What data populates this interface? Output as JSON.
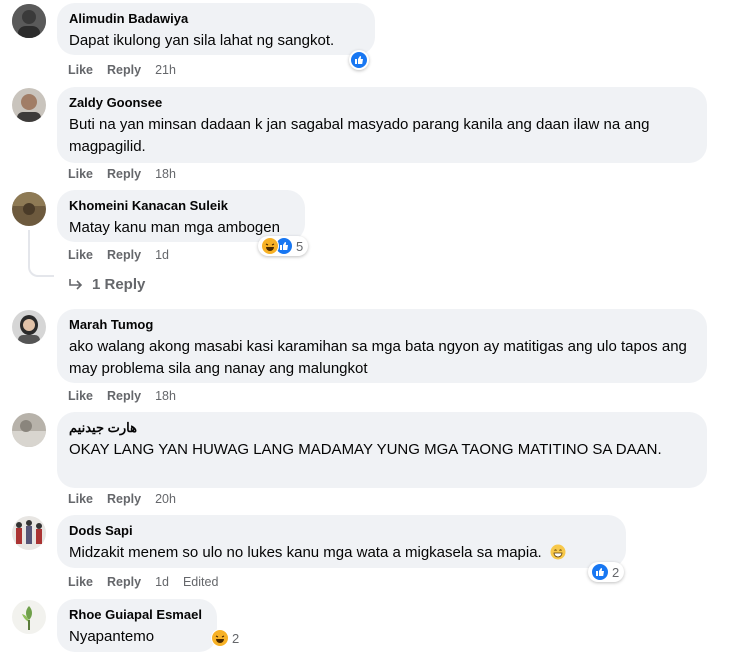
{
  "comments": [
    {
      "author": "Alimudin Badawiya",
      "text": "Dapat ikulong yan sila lahat ng sangkot.",
      "like_label": "Like",
      "reply_label": "Reply",
      "time": "21h",
      "reaction_icons": [
        "like-icon"
      ],
      "reaction_count": ""
    },
    {
      "author": "Zaldy Goonsee",
      "text": "Buti na yan minsan dadaan k jan sagabal masyado parang kanila ang daan ilaw na ang magpagilid.",
      "like_label": "Like",
      "reply_label": "Reply",
      "time": "18h"
    },
    {
      "author": "Khomeini Kanacan Suleik",
      "text": "Matay kanu man mga ambogen",
      "like_label": "Like",
      "reply_label": "Reply",
      "time": "1d",
      "reaction_icons": [
        "haha-icon",
        "like-icon"
      ],
      "reaction_count": "5",
      "replies_label": "1 Reply"
    },
    {
      "author": "Marah Tumog",
      "text": "ako walang akong masabi kasi karamihan sa mga bata ngyon ay matitigas ang ulo tapos ang may problema sila ang nanay ang malungkot",
      "like_label": "Like",
      "reply_label": "Reply",
      "time": "18h"
    },
    {
      "author": "هارت جيدنيم",
      "text": "OKAY LANG YAN HUWAG LANG MADAMAY YUNG MGA TAONG MATITINO SA DAAN.",
      "like_label": "Like",
      "reply_label": "Reply",
      "time": "20h"
    },
    {
      "author": "Dods Sapi",
      "text": "Midzakit menem so ulo no lukes kanu mga wata a migkasela sa mapia.",
      "like_label": "Like",
      "reply_label": "Reply",
      "time": "1d",
      "edited_label": "Edited",
      "reaction_icons": [
        "like-icon"
      ],
      "reaction_count": "2"
    },
    {
      "author": "Rhoe Guiapal Esmael",
      "text": "Nyapantemo",
      "reaction_icons": [
        "haha-icon"
      ],
      "reaction_count": "2"
    }
  ],
  "colors": {
    "bubble": "#f0f2f5",
    "meta_text": "#65676b",
    "like_blue": "#1877f2",
    "haha_yellow": "#f7b125"
  }
}
